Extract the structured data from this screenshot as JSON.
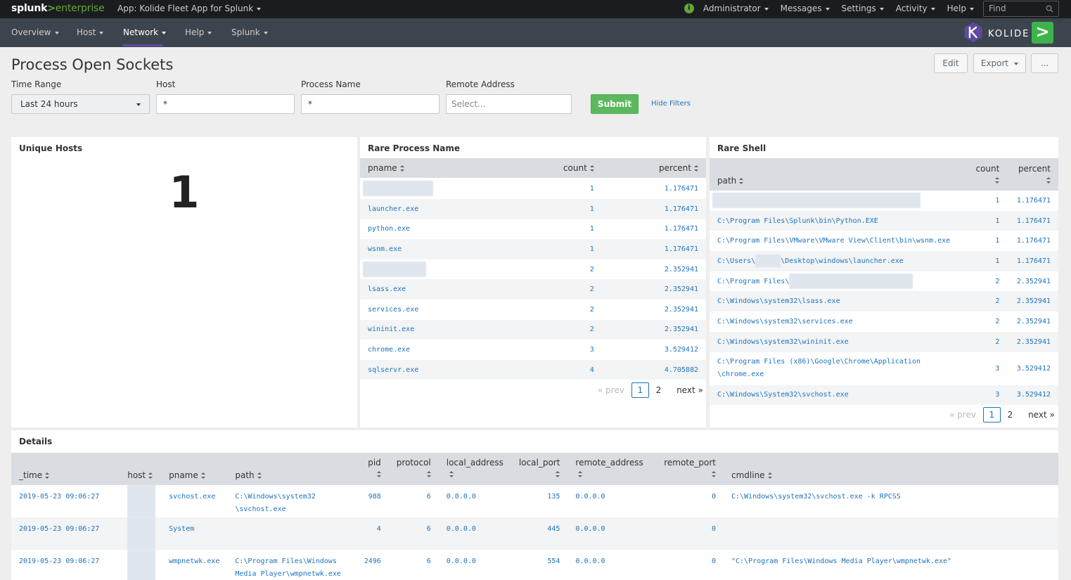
{
  "topbar": {
    "logo_splunk": "splunk",
    "logo_gt": ">",
    "logo_enterprise": "enterprise",
    "app_name": "App: Kolide Fleet App for Splunk",
    "menus": [
      "Administrator",
      "Messages",
      "Settings",
      "Activity",
      "Help"
    ],
    "find_placeholder": "Find"
  },
  "appbar": {
    "nav": [
      "Overview",
      "Host",
      "Network",
      "Help",
      "Splunk"
    ],
    "active": "Network",
    "brand": "KOLIDE"
  },
  "page": {
    "title": "Process Open Sockets",
    "buttons": {
      "edit": "Edit",
      "export": "Export",
      "more": "..."
    }
  },
  "filters": {
    "time_range": {
      "label": "Time Range",
      "value": "Last 24 hours"
    },
    "host": {
      "label": "Host",
      "value": "*"
    },
    "process_name": {
      "label": "Process Name",
      "value": "*"
    },
    "remote_address": {
      "label": "Remote Address",
      "placeholder": "Select..."
    },
    "submit": "Submit",
    "hide_filters": "Hide Filters"
  },
  "unique_hosts": {
    "title": "Unique Hosts",
    "value": "1"
  },
  "rare_process": {
    "title": "Rare Process Name",
    "columns": [
      "pname",
      "count",
      "percent"
    ],
    "rows": [
      {
        "pname": "",
        "count": "1",
        "percent": "1.176471"
      },
      {
        "pname": "launcher.exe",
        "count": "1",
        "percent": "1.176471"
      },
      {
        "pname": "python.exe",
        "count": "1",
        "percent": "1.176471"
      },
      {
        "pname": "wsnm.exe",
        "count": "1",
        "percent": "1.176471"
      },
      {
        "pname": "",
        "count": "2",
        "percent": "2.352941"
      },
      {
        "pname": "lsass.exe",
        "count": "2",
        "percent": "2.352941"
      },
      {
        "pname": "services.exe",
        "count": "2",
        "percent": "2.352941"
      },
      {
        "pname": "wininit.exe",
        "count": "2",
        "percent": "2.352941"
      },
      {
        "pname": "chrome.exe",
        "count": "3",
        "percent": "3.529412"
      },
      {
        "pname": "sqlservr.exe",
        "count": "4",
        "percent": "4.705882"
      }
    ],
    "pager": {
      "prev": "« prev",
      "current": "1",
      "page2": "2",
      "next": "next »"
    }
  },
  "rare_shell": {
    "title": "Rare Shell",
    "columns": [
      "path",
      "count",
      "percent"
    ],
    "rows": [
      {
        "path": "",
        "count": "1",
        "percent": "1.176471"
      },
      {
        "path": "C:\\Program Files\\Splunk\\bin\\Python.EXE",
        "count": "1",
        "percent": "1.176471"
      },
      {
        "path": "C:\\Program Files\\VMware\\VMware View\\Client\\bin\\wsnm.exe",
        "count": "1",
        "percent": "1.176471"
      },
      {
        "path_a": "C:\\Users\\",
        "path_b": "\\Desktop\\windows\\launcher.exe",
        "count": "1",
        "percent": "1.176471"
      },
      {
        "path": "C:\\Program Files\\",
        "count": "2",
        "percent": "2.352941"
      },
      {
        "path": "C:\\Windows\\system32\\lsass.exe",
        "count": "2",
        "percent": "2.352941"
      },
      {
        "path": "C:\\Windows\\system32\\services.exe",
        "count": "2",
        "percent": "2.352941"
      },
      {
        "path": "C:\\Windows\\system32\\wininit.exe",
        "count": "2",
        "percent": "2.352941"
      },
      {
        "path": "C:\\Program Files (x86)\\Google\\Chrome\\Application",
        "path_2": "\\chrome.exe",
        "count": "3",
        "percent": "3.529412"
      },
      {
        "path": "C:\\Windows\\System32\\svchost.exe",
        "count": "3",
        "percent": "3.529412"
      }
    ],
    "pager": {
      "prev": "« prev",
      "current": "1",
      "page2": "2",
      "next": "next »"
    }
  },
  "details": {
    "title": "Details",
    "columns": [
      "_time",
      "host",
      "pname",
      "path",
      "pid",
      "protocol",
      "local_address",
      "local_port",
      "remote_address",
      "remote_port",
      "cmdline"
    ],
    "rows": [
      {
        "time": "2019-05-23 09:06:27",
        "pname": "svchost.exe",
        "path_1": "C:\\Windows\\system32",
        "path_2": "\\svchost.exe",
        "pid": "988",
        "protocol": "6",
        "local_address": "0.0.0.0",
        "local_port": "135",
        "remote_address": "0.0.0.0",
        "remote_port": "0",
        "cmdline": "C:\\Windows\\system32\\svchost.exe -k RPCSS"
      },
      {
        "time": "2019-05-23 09:06:27",
        "pname": "System",
        "path_1": "",
        "path_2": "",
        "pid": "4",
        "protocol": "6",
        "local_address": "0.0.0.0",
        "local_port": "445",
        "remote_address": "0.0.0.0",
        "remote_port": "0",
        "cmdline": ""
      },
      {
        "time": "2019-05-23 09:06:27",
        "pname": "wmpnetwk.exe",
        "path_1": "C:\\Program Files\\Windows",
        "path_2": "Media Player\\wmpnetwk.exe",
        "pid": "2496",
        "protocol": "6",
        "local_address": "0.0.0.0",
        "local_port": "554",
        "remote_address": "0.0.0.0",
        "remote_port": "0",
        "cmdline": "\"C:\\Program Files\\Windows Media Player\\wmpnetwk.exe\""
      }
    ]
  },
  "colors": {
    "accent_green": "#65a637",
    "link_blue": "#1e73be",
    "appbar": "#3c444d",
    "topbar": "#1a1c20",
    "nav_underline": "#5c4ba0"
  }
}
